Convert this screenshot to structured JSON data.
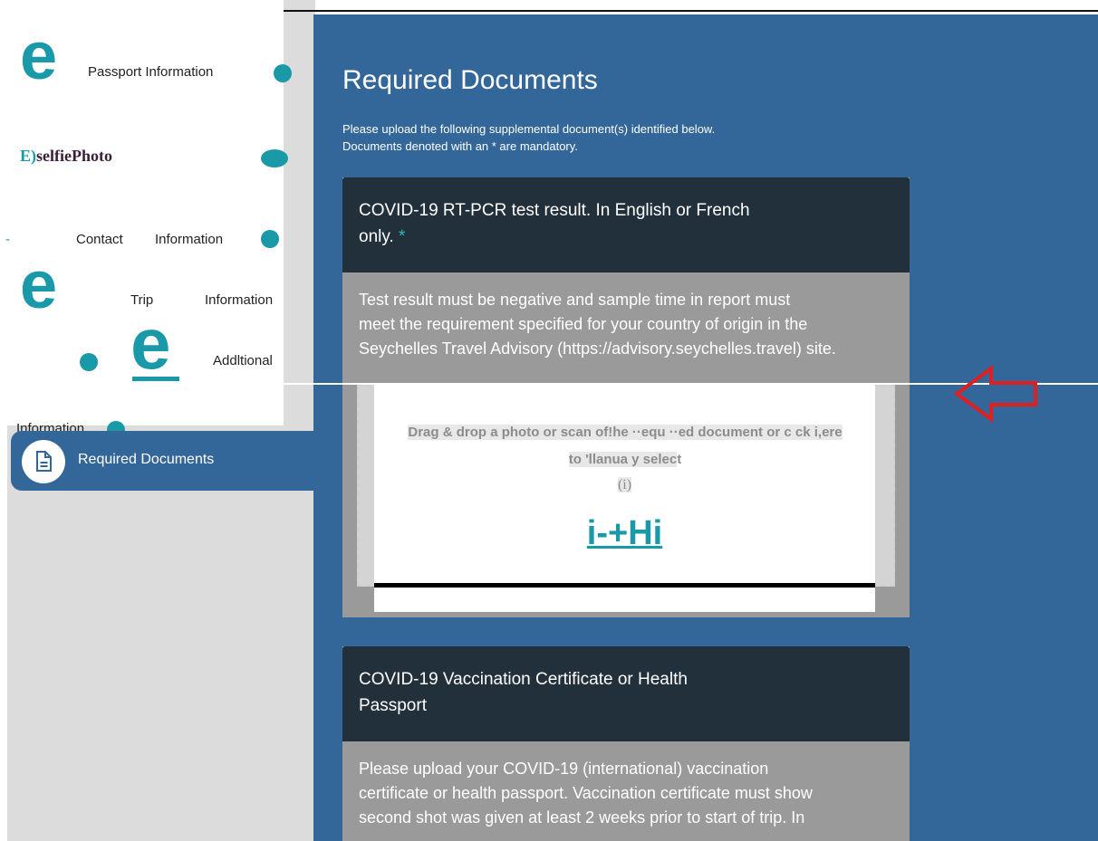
{
  "sidebar": {
    "step_badge": "e",
    "items": [
      {
        "label": "Passport Information"
      },
      {
        "label_prefix": "E)",
        "label": "selfiePhoto"
      },
      {
        "label_prefix": "-",
        "label_a": "Contact",
        "label_b": "Information"
      },
      {
        "label_a": "Trip",
        "label_b": "Information"
      },
      {
        "label": "Addltional"
      },
      {
        "label": "Information"
      }
    ],
    "active": {
      "label": "Required Documents",
      "icon": "document-icon"
    }
  },
  "main": {
    "title": "Required Documents",
    "intro_line1": "Please upload the following supplemental document(s) identified below.",
    "intro_line2": "Documents denoted with an * are mandatory."
  },
  "cards": [
    {
      "title_line1": "COVID-19 RT-PCR test result. In English or French",
      "title_line2": "only.",
      "mandatory_mark": "*",
      "body_line1": "Test result must be negative and sample time in report must",
      "body_line2": "meet the requirement specified for your country of origin in the",
      "body_line3": "Seychelles Travel Advisory (https://advisory.seychelles.travel) site.",
      "dropzone": {
        "line1": "Drag & drop a photo or scan of!he ··equ ··ed document or c  ck i,ere",
        "line2_a": "to 'llanua y selec",
        "line2_b": "t",
        "info": "(i)",
        "upload": "i-+Hi"
      }
    },
    {
      "title_line1": "COVID-19 Vaccination Certificate or Health",
      "title_line2": "Passport",
      "body_line1": "Please upload your COVID-19 (international) vaccination",
      "body_line2": "certificate or health passport. Vaccination certificate must show",
      "body_line3": "second shot was given at least 2 weeks prior to start of trip. In"
    }
  ],
  "overlay": {
    "arrow_color": "#e02020",
    "icon": "left-arrow-icon"
  },
  "colors": {
    "accent": "#1a9aa8",
    "panel": "#336699",
    "card_header": "#22303b",
    "card_body": "#9a9a9a"
  }
}
